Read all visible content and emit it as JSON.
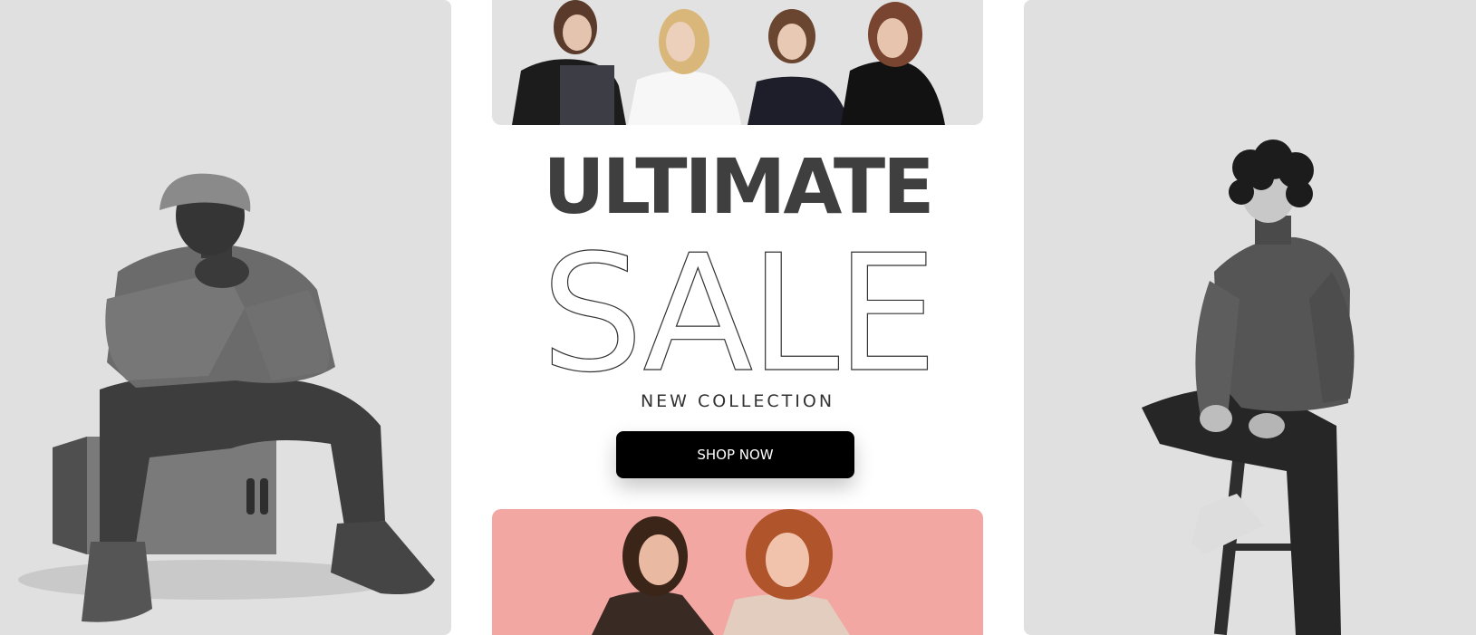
{
  "banner": {
    "headline": "ULTIMATE",
    "sale_text": "SALE",
    "subheadline": "NEW COLLECTION",
    "cta_label": "SHOP NOW"
  },
  "colors": {
    "page_background": "#ffffff",
    "panel_gray": "#e0e0e0",
    "panel_pink": "#f3a7a2",
    "headline_text": "#3f3f3f",
    "button_background": "#000000",
    "button_text": "#ffffff"
  },
  "images": {
    "left_panel": "man-seated-on-wooden-box-photo",
    "top_panel": "four-women-group-photo",
    "bottom_panel": "two-women-laughing-photo",
    "right_panel": "man-on-stool-photo"
  }
}
